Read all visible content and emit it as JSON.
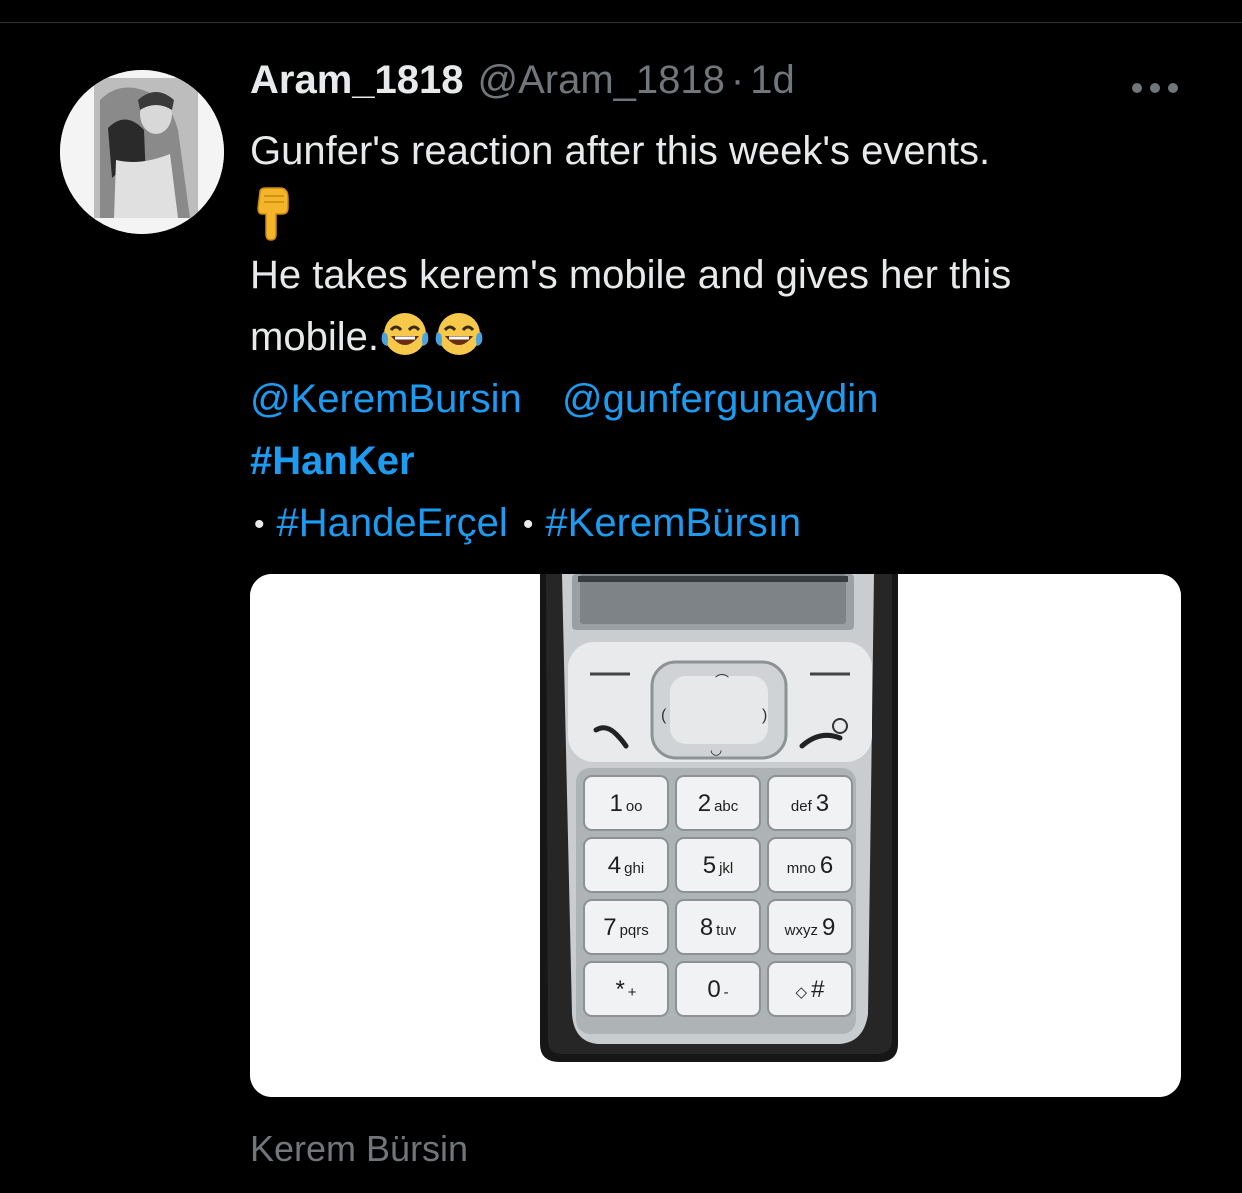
{
  "tweet": {
    "author_name": "Aram_1818",
    "handle": "@Aram_1818",
    "separator": "·",
    "time": "1d",
    "more_icon": "more-horizontal-icon",
    "line1": "Gunfer's reaction after this week's events.",
    "line2_emoji": "pointing-down-hand-emoji",
    "line3": "He takes kerem's mobile and gives her this",
    "line4_text": "mobile.",
    "line4_emojis": "face-with-tears-of-joy-emoji",
    "mention1": "@KeremBursin",
    "mention2": "@gunfergunaydin",
    "hashtag1": "#HanKer",
    "bullet": "•",
    "hashtag2": "#HandeErçel",
    "hashtag3": "#KeremBürsın",
    "media_caption": "Kerem Bürsin"
  },
  "phone": {
    "keys": [
      {
        "main": "1",
        "sub": "oo"
      },
      {
        "main": "2",
        "sub": "abc"
      },
      {
        "main": "3",
        "sub": "def"
      },
      {
        "main": "4",
        "sub": "ghi"
      },
      {
        "main": "5",
        "sub": "jkl"
      },
      {
        "main": "6",
        "sub": "mno"
      },
      {
        "main": "7",
        "sub": "pqrs"
      },
      {
        "main": "8",
        "sub": "tuv"
      },
      {
        "main": "9",
        "sub": "wxyz"
      },
      {
        "main": "*",
        "sub": "+"
      },
      {
        "main": "0",
        "sub": "-"
      },
      {
        "main": "#",
        "sub": "◇"
      }
    ]
  },
  "colors": {
    "background": "#000000",
    "text": "#e7e9ea",
    "muted": "#71767b",
    "link": "#1d9bf0"
  }
}
